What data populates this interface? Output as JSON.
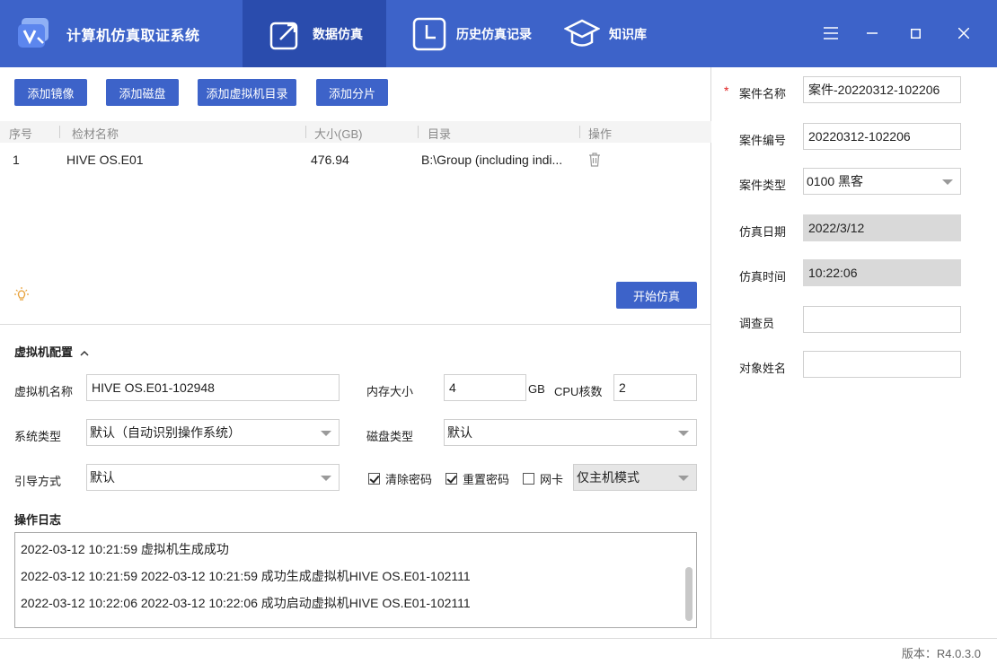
{
  "app": {
    "title": "计算机仿真取证系统",
    "logo_text": "V"
  },
  "nav": {
    "tabs": [
      {
        "label": "数据仿真",
        "icon": "export-arrow-icon",
        "active": true
      },
      {
        "label": "历史仿真记录",
        "icon": "clock-icon",
        "active": false
      },
      {
        "label": "知识库",
        "icon": "graduation-cap-icon",
        "active": false
      }
    ]
  },
  "toolbar": {
    "add_image": "添加镜像",
    "add_disk": "添加磁盘",
    "add_vm_dir": "添加虚拟机目录",
    "add_partition": "添加分片"
  },
  "table": {
    "headers": [
      "序号",
      "检材名称",
      "大小(GB)",
      "目录",
      "操作"
    ],
    "rows": [
      {
        "index": "1",
        "name": "HIVE OS.E01",
        "size": "476.94",
        "dir": "B:\\Group (including indi..."
      }
    ]
  },
  "actions": {
    "start_sim": "开始仿真"
  },
  "vm_config": {
    "section_title": "虚拟机配置",
    "vm_name_label": "虚拟机名称",
    "vm_name_value": "HIVE OS.E01-102948",
    "memory_label": "内存大小",
    "memory_value": "4",
    "memory_unit": "GB",
    "cpu_label": "CPU核数",
    "cpu_value": "2",
    "os_type_label": "系统类型",
    "os_type_value": "默认（自动识别操作系统）",
    "disk_type_label": "磁盘类型",
    "disk_type_value": "默认",
    "boot_label": "引导方式",
    "boot_value": "默认",
    "clear_pwd_label": "清除密码",
    "clear_pwd_checked": true,
    "reset_pwd_label": "重置密码",
    "reset_pwd_checked": true,
    "nic_label": "网卡",
    "nic_checked": false,
    "nic_mode_value": "仅主机模式"
  },
  "log": {
    "title": "操作日志",
    "lines": [
      "2022-03-12 10:21:59 虚拟机生成成功",
      "2022-03-12 10:21:59 2022-03-12 10:21:59  成功生成虚拟机HIVE OS.E01-102111",
      "2022-03-12 10:22:06 2022-03-12 10:22:06  成功启动虚拟机HIVE OS.E01-102111"
    ]
  },
  "case": {
    "name_label": "案件名称",
    "name_value": "案件-20220312-102206",
    "number_label": "案件编号",
    "number_value": "20220312-102206",
    "type_label": "案件类型",
    "type_value": "0100 黑客",
    "date_label": "仿真日期",
    "date_value": "2022/3/12",
    "time_label": "仿真时间",
    "time_value": "10:22:06",
    "investigator_label": "调查员",
    "investigator_value": "",
    "subject_label": "对象姓名",
    "subject_value": "",
    "required_mark": "*"
  },
  "status": {
    "version": "版本：R4.0.3.0"
  },
  "colors": {
    "brand": "#3d63c9",
    "brand_dark": "#2a4cad"
  }
}
